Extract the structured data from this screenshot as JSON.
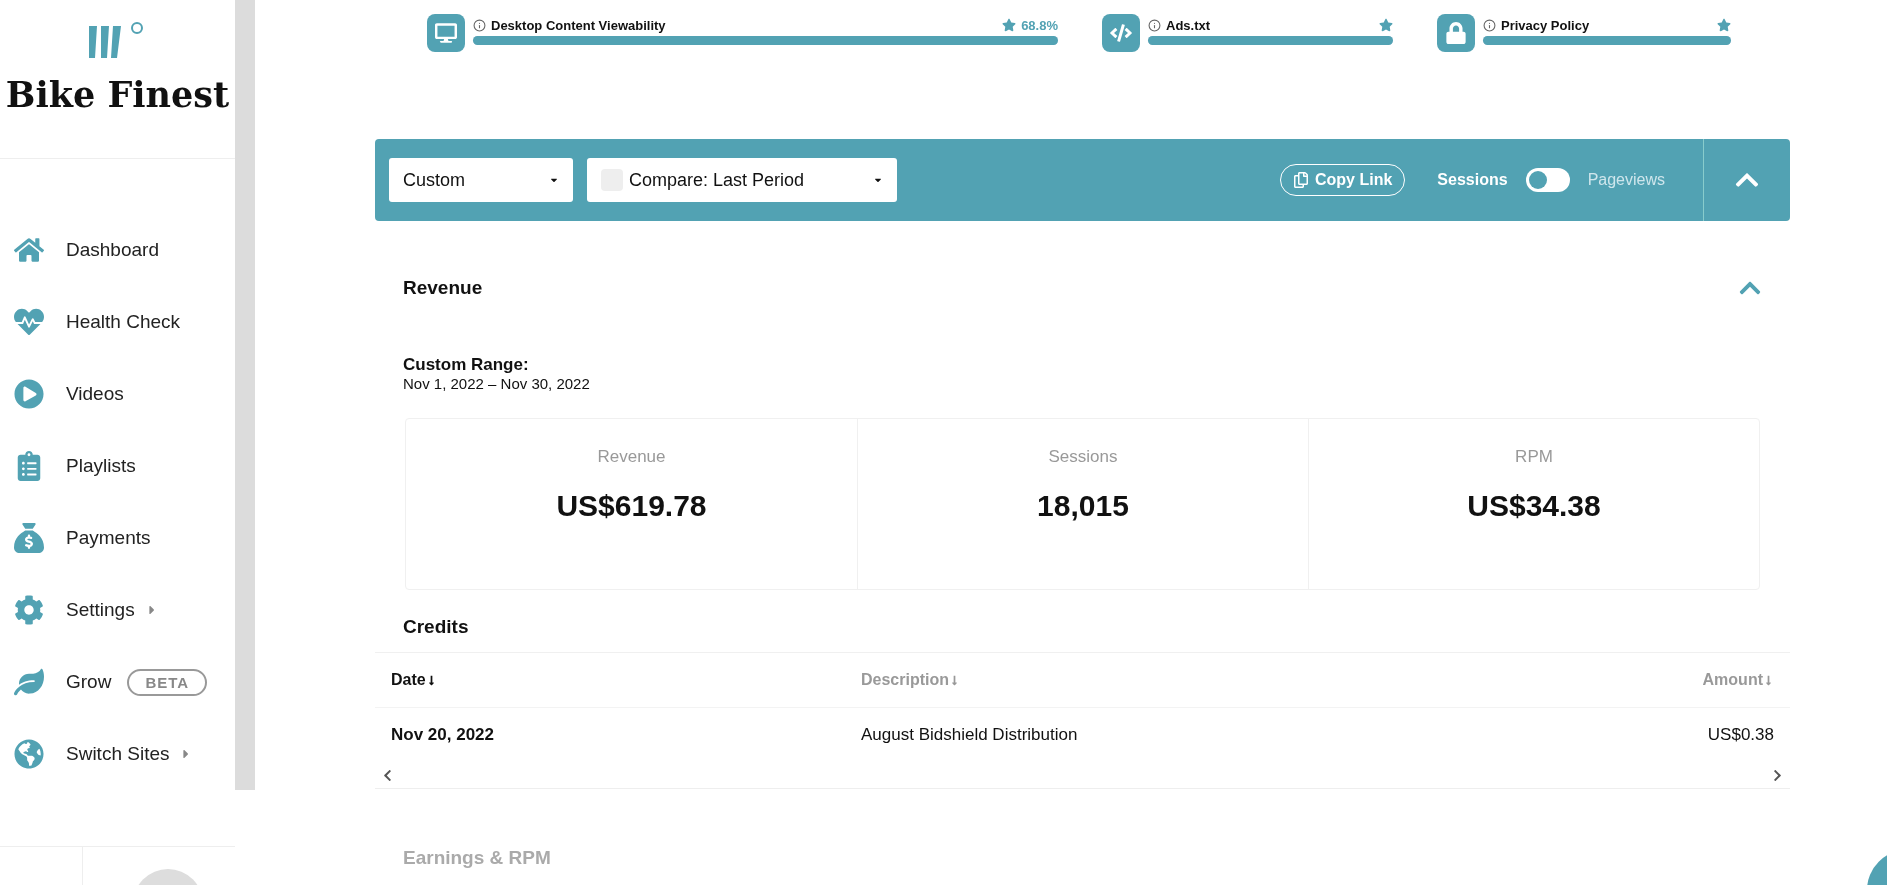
{
  "brand": {
    "name": "Bike Finest"
  },
  "sidebar": {
    "items": [
      {
        "label": "Dashboard",
        "submenu": false
      },
      {
        "label": "Health Check",
        "submenu": false
      },
      {
        "label": "Videos",
        "submenu": false
      },
      {
        "label": "Playlists",
        "submenu": false
      },
      {
        "label": "Payments",
        "submenu": false
      },
      {
        "label": "Settings",
        "submenu": true
      },
      {
        "label": "Grow",
        "submenu": false,
        "badge": "BETA"
      },
      {
        "label": "Switch Sites",
        "submenu": true
      }
    ]
  },
  "health": [
    {
      "label": "Desktop Content Viewability",
      "reading": "68.8%",
      "level": 1
    },
    {
      "label": "Ads.txt",
      "level": 1
    },
    {
      "label": "Privacy Policy",
      "level": 1
    }
  ],
  "toolbar": {
    "range": "Custom",
    "compare": {
      "label": "Compare: Last Period",
      "checked": false
    },
    "copy_link": "Copy Link",
    "toggle": {
      "left": "Sessions",
      "right": "Pageviews",
      "on": false
    }
  },
  "revenue": {
    "title": "Revenue",
    "expanded": true,
    "range_label": "Custom Range:",
    "range": "Nov 1, 2022 – Nov 30, 2022",
    "stats": [
      {
        "label": "Revenue",
        "value": "US$619.78"
      },
      {
        "label": "Sessions",
        "value": "18,015"
      },
      {
        "label": "RPM",
        "value": "US$34.38"
      }
    ]
  },
  "credits": {
    "title": "Credits",
    "columns": [
      {
        "label": "Date",
        "active": true
      },
      {
        "label": "Description",
        "active": false
      },
      {
        "label": "Amount",
        "active": false
      }
    ],
    "rows": [
      [
        "Nov 20, 2022",
        "August Bidshield Distribution",
        "US$0.38"
      ]
    ]
  },
  "next_section": {
    "title": "Earnings & RPM"
  }
}
